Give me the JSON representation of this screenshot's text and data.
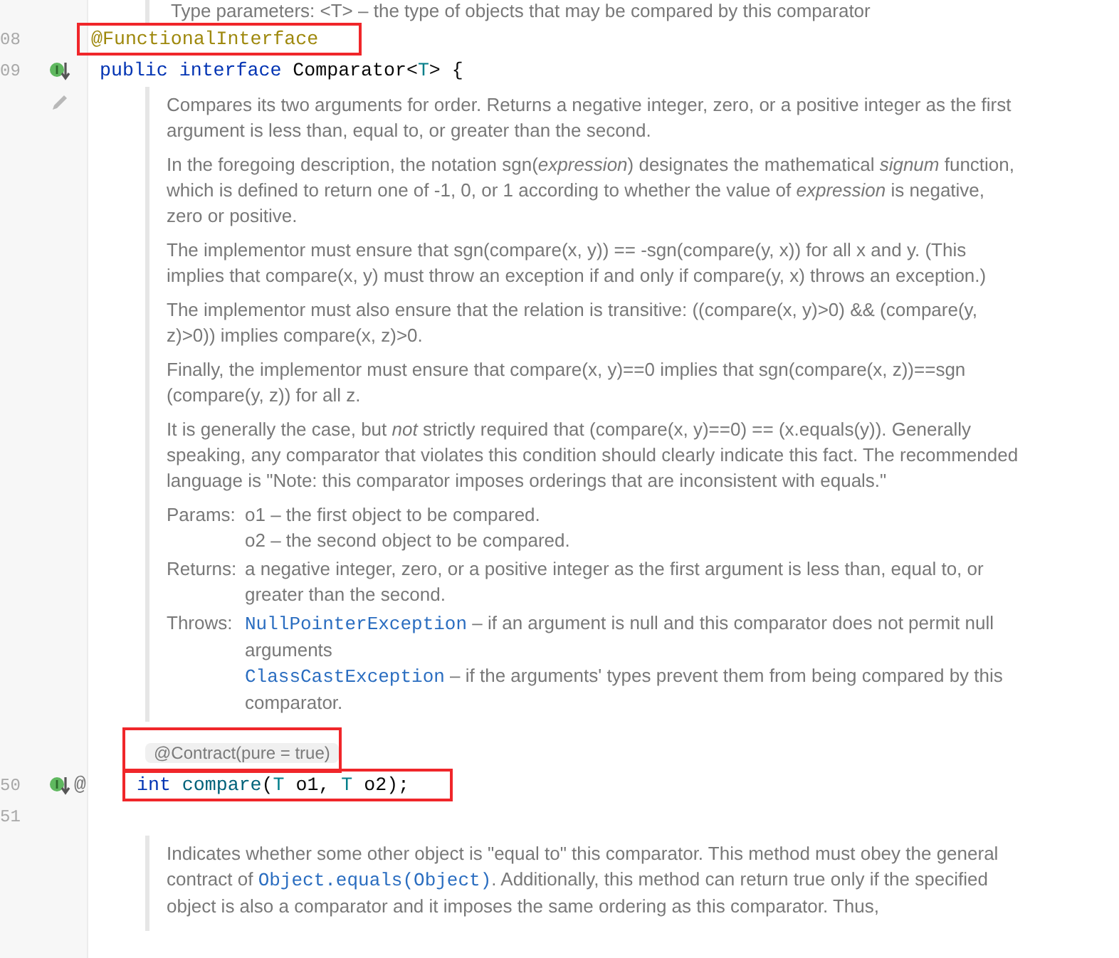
{
  "top_doc_line": "Type parameters: <T> – the type of objects that may be compared by this comparator",
  "blocks": [
    {
      "kind": "code",
      "number": "08",
      "highlighted": true,
      "tokens": [
        {
          "kind": "annotation",
          "text": "@FunctionalInterface"
        }
      ]
    },
    {
      "kind": "code",
      "number": "09",
      "implemented": true,
      "highlighted": false,
      "tokens": [
        {
          "kind": "keyword",
          "text": "public "
        },
        {
          "kind": "keyword",
          "text": "interface "
        },
        {
          "kind": "plain",
          "text": "Comparator<"
        },
        {
          "kind": "typeparam",
          "text": "T"
        },
        {
          "kind": "plain",
          "text": "> {"
        }
      ],
      "children": [
        {
          "kind": "doc",
          "editable": true,
          "paragraphs": [
            [
              {
                "kind": "text",
                "text": "Compares its two arguments for order. Returns a negative integer, zero, or a positive integer as the first argument is less than, equal to, or greater than the second."
              }
            ],
            [
              {
                "kind": "text",
                "text": "In the foregoing description, the notation sgn(*expression*) designates the mathematical *signum* function, which is defined to return one of -1, 0, or 1 according to whether the value of *expression* is negative, zero or positive."
              }
            ],
            [
              {
                "kind": "text",
                "text": "The implementor must ensure that sgn(compare(x, y)) == -sgn(compare(y, x)) for all x and y. (This implies that compare(x, y) must throw an exception if and only if compare(y, x) throws an exception.)"
              }
            ],
            [
              {
                "kind": "text",
                "text": "The implementor must also ensure that the relation is transitive: ((compare(x, y)>0) && (compare(y, z)>0)) implies compare(x, z)>0."
              }
            ],
            [
              {
                "kind": "text",
                "text": "Finally, the implementor must ensure that compare(x, y)==0 implies that sgn(compare(x, z))==sgn (compare(y, z)) for all z."
              }
            ],
            [
              {
                "kind": "text",
                "text": "It is generally the case, but *not* strictly required that (compare(x, y)==0) == (x.equals(y)). Generally speaking, any comparator that violates this condition should clearly indicate this fact. The recommended language is \"Note: this comparator imposes orderings that are inconsistent with equals.\""
              }
            ]
          ],
          "sections": [
            {
              "label": "Params:",
              "items": [
                [
                  {
                    "kind": "text",
                    "text": "o1 – the first object to be compared."
                  }
                ],
                [
                  {
                    "kind": "text",
                    "text": "o2 – the second object to be compared."
                  }
                ]
              ]
            },
            {
              "label": "Returns:",
              "items": [
                [
                  {
                    "kind": "text",
                    "text": "a negative integer, zero, or a positive integer as the first argument is less than, equal to, or greater than the second."
                  }
                ]
              ]
            },
            {
              "label": "Throws:",
              "items": [
                [
                  {
                    "kind": "link",
                    "text": "NullPointerException"
                  },
                  {
                    "kind": "text",
                    "text": " – if an argument is null and this comparator does not permit null arguments"
                  }
                ],
                [
                  {
                    "kind": "link",
                    "text": "ClassCastException"
                  },
                  {
                    "kind": "text",
                    "text": " – if the arguments' types prevent them from being compared by this comparator."
                  }
                ]
              ]
            }
          ]
        },
        {
          "kind": "inlay",
          "text": "@Contract(pure = true)",
          "highlighted": true
        },
        {
          "kind": "code",
          "number": "50",
          "implemented": true,
          "marker": "@",
          "highlighted": true,
          "tokens": [
            {
              "kind": "keyword",
              "text": "int "
            },
            {
              "kind": "method",
              "text": "compare"
            },
            {
              "kind": "plain",
              "text": "("
            },
            {
              "kind": "typeparam",
              "text": "T"
            },
            {
              "kind": "plain",
              "text": " o1, "
            },
            {
              "kind": "typeparam",
              "text": "T"
            },
            {
              "kind": "plain",
              "text": " o2);"
            }
          ]
        },
        {
          "kind": "code",
          "number": "51",
          "highlighted": false
        },
        {
          "kind": "doc",
          "editable": false,
          "paragraphs": [
            [
              {
                "kind": "text",
                "text": "Indicates whether some other object is \"equal to\" this comparator. This method must obey the general contract of "
              },
              {
                "kind": "link",
                "text": "Object.equals(Object)"
              },
              {
                "kind": "text",
                "text": ". Additionally, this method can return true only if the specified object is also a comparator and it imposes the same ordering as this comparator. Thus,"
              }
            ]
          ]
        }
      ]
    }
  ]
}
